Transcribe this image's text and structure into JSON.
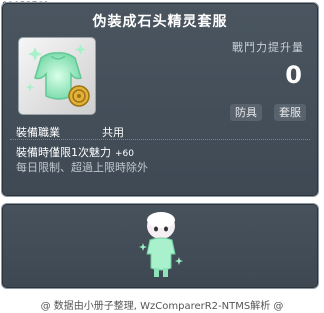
{
  "item_id": "01053761",
  "tooltip": {
    "title": "伪装成石头精灵套服",
    "power_label": "戰鬥力提升量",
    "power_value": "0",
    "tags": [
      "防具",
      "套服"
    ],
    "job_label": "裝備職業",
    "job_value": "共用",
    "limit_text": "裝備時僅限1次魅力",
    "limit_bonus": "+60",
    "limit_desc": "每日限制、超過上限時除外"
  },
  "footer": "@ 数据由小册子整理, WzComparerR2-NTMS解析 @",
  "icons": {
    "item_icon": "green-overall-icon",
    "badge": "gold-coin-badge-icon",
    "preview": "character-preview"
  },
  "colors": {
    "panel": "#434e59",
    "accent_green": "#9ff2c4",
    "coin": "#e2b13a"
  }
}
